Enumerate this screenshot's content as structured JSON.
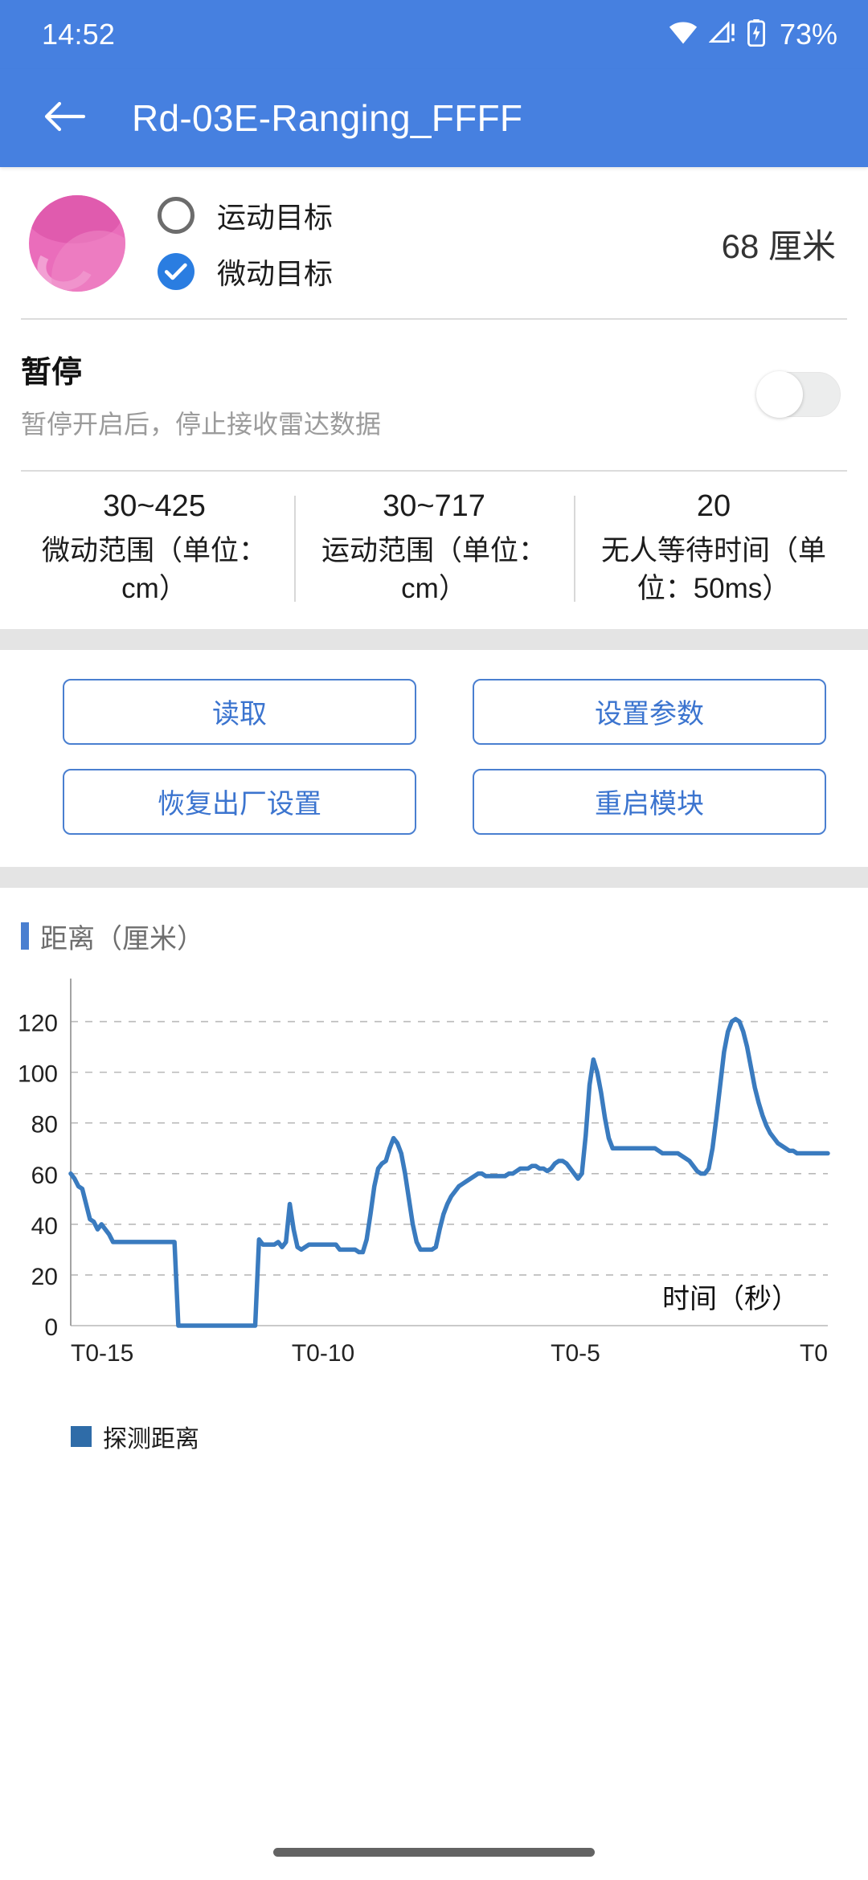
{
  "status_bar": {
    "time": "14:52",
    "battery_percent": "73%",
    "icons": [
      "wifi-icon",
      "cellular-alert-icon",
      "battery-charging-icon"
    ]
  },
  "app_bar": {
    "back_icon": "arrow-left-icon",
    "title": "Rd-03E-Ranging_FFFF"
  },
  "target": {
    "ball_icon": "pink-ball-icon",
    "options": [
      {
        "label": "运动目标",
        "selected": false
      },
      {
        "label": "微动目标",
        "selected": true
      }
    ],
    "distance": "68 厘米"
  },
  "pause": {
    "title": "暂停",
    "subtitle": "暂停开启后，停止接收雷达数据",
    "toggle_on": false
  },
  "params": [
    {
      "value": "30~425",
      "label": "微动范围（单位：cm）"
    },
    {
      "value": "30~717",
      "label": "运动范围（单位：cm）"
    },
    {
      "value": "20",
      "label": "无人等待时间（单位：50ms）"
    }
  ],
  "actions": [
    {
      "label": "读取"
    },
    {
      "label": "设置参数"
    },
    {
      "label": "恢复出厂设置"
    },
    {
      "label": "重启模块"
    }
  ],
  "chart_header": {
    "title": "距离（厘米）"
  },
  "colors": {
    "primary": "#4680e0",
    "accent": "#2a7de1",
    "line": "#3a7bbf",
    "button_border": "#4a7fd0",
    "ball": "#ea6dbb"
  },
  "chart_data": {
    "type": "line",
    "title": "距离（厘米）",
    "xlabel": "时间（秒）",
    "ylabel": "距离（厘米）",
    "grid": true,
    "legend_position": "bottom-left",
    "series": [
      {
        "name": "探测距离",
        "color": "#3a7bbf",
        "values": [
          60,
          58,
          55,
          54,
          48,
          42,
          41,
          38,
          40,
          38,
          36,
          33,
          33,
          33,
          33,
          33,
          33,
          33,
          33,
          33,
          33,
          33,
          33,
          33,
          33,
          33,
          33,
          33,
          0,
          0,
          0,
          0,
          0,
          0,
          0,
          0,
          0,
          0,
          0,
          0,
          0,
          0,
          0,
          0,
          0,
          0,
          0,
          0,
          0,
          34,
          32,
          32,
          32,
          32,
          33,
          31,
          33,
          48,
          38,
          31,
          30,
          31,
          32,
          32,
          32,
          32,
          32,
          32,
          32,
          32,
          30,
          30,
          30,
          30,
          30,
          29,
          29,
          34,
          44,
          55,
          62,
          64,
          65,
          70,
          74,
          72,
          68,
          60,
          50,
          40,
          33,
          30,
          30,
          30,
          30,
          31,
          38,
          44,
          48,
          51,
          53,
          55,
          56,
          57,
          58,
          59,
          60,
          60,
          59,
          59,
          59,
          59,
          59,
          59,
          60,
          60,
          61,
          62,
          62,
          62,
          63,
          63,
          62,
          62,
          61,
          62,
          64,
          65,
          65,
          64,
          62,
          60,
          58,
          60,
          75,
          95,
          105,
          100,
          92,
          82,
          74,
          70,
          70,
          70,
          70,
          70,
          70,
          70,
          70,
          70,
          70,
          70,
          70,
          69,
          68,
          68,
          68,
          68,
          68,
          67,
          66,
          65,
          63,
          61,
          60,
          60,
          62,
          70,
          82,
          95,
          108,
          116,
          120,
          121,
          120,
          116,
          110,
          102,
          94,
          88,
          83,
          79,
          76,
          74,
          72,
          71,
          70,
          69,
          69,
          68,
          68,
          68,
          68,
          68,
          68,
          68,
          68,
          68
        ]
      }
    ],
    "ylim": [
      0,
      130
    ],
    "yticks": [
      0,
      20,
      40,
      60,
      80,
      100,
      120
    ],
    "xticks": [
      "T0-15",
      "T0-10",
      "T0-5",
      "T0"
    ],
    "legend_entries": [
      "探测距离"
    ]
  }
}
